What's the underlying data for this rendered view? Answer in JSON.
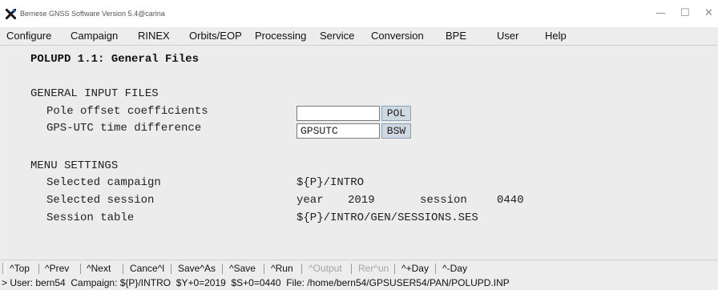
{
  "window": {
    "title": "Bernese GNSS Software Version 5.4@carina",
    "controls": [
      "—",
      "☐",
      "✕"
    ]
  },
  "menu": [
    "Configure",
    "Campaign",
    "RINEX",
    "Orbits/EOP",
    "Processing",
    "Service",
    "Conversion",
    "BPE",
    "User",
    "Help"
  ],
  "panel": {
    "title": "POLUPD 1.1: General Files",
    "general_input_header": "GENERAL INPUT FILES",
    "pole_label": "Pole offset coefficients",
    "pole_value": "",
    "pole_button": "POL",
    "gpsutc_label": "GPS-UTC time difference",
    "gpsutc_value": "GPSUTC",
    "gpsutc_button": "BSW",
    "menu_settings_header": "MENU SETTINGS",
    "campaign_label": "Selected campaign",
    "campaign_value": "${P}/INTRO",
    "session_label": "Selected session",
    "year_label": "year",
    "year_value": "2019",
    "session_word": "session",
    "session_value": "0440",
    "session_table_label": "Session table",
    "session_table_value": "${P}/INTRO/GEN/SESSIONS.SES"
  },
  "toolbar": {
    "top": "^Top",
    "prev": "^Prev",
    "next": "^Next",
    "cancel": "Cance^l",
    "saveas": "Save^As",
    "save": "^Save",
    "run": "^Run",
    "output": "^Output",
    "rerun": "Rer^un",
    "plusday": "^+Day",
    "minusday": "^-Day"
  },
  "status": "> User: bern54  Campaign: ${P}/INTRO  $Y+0=2019  $S+0=0440  File: /home/bern54/GPSUSER54/PAN/POLUPD.INP"
}
